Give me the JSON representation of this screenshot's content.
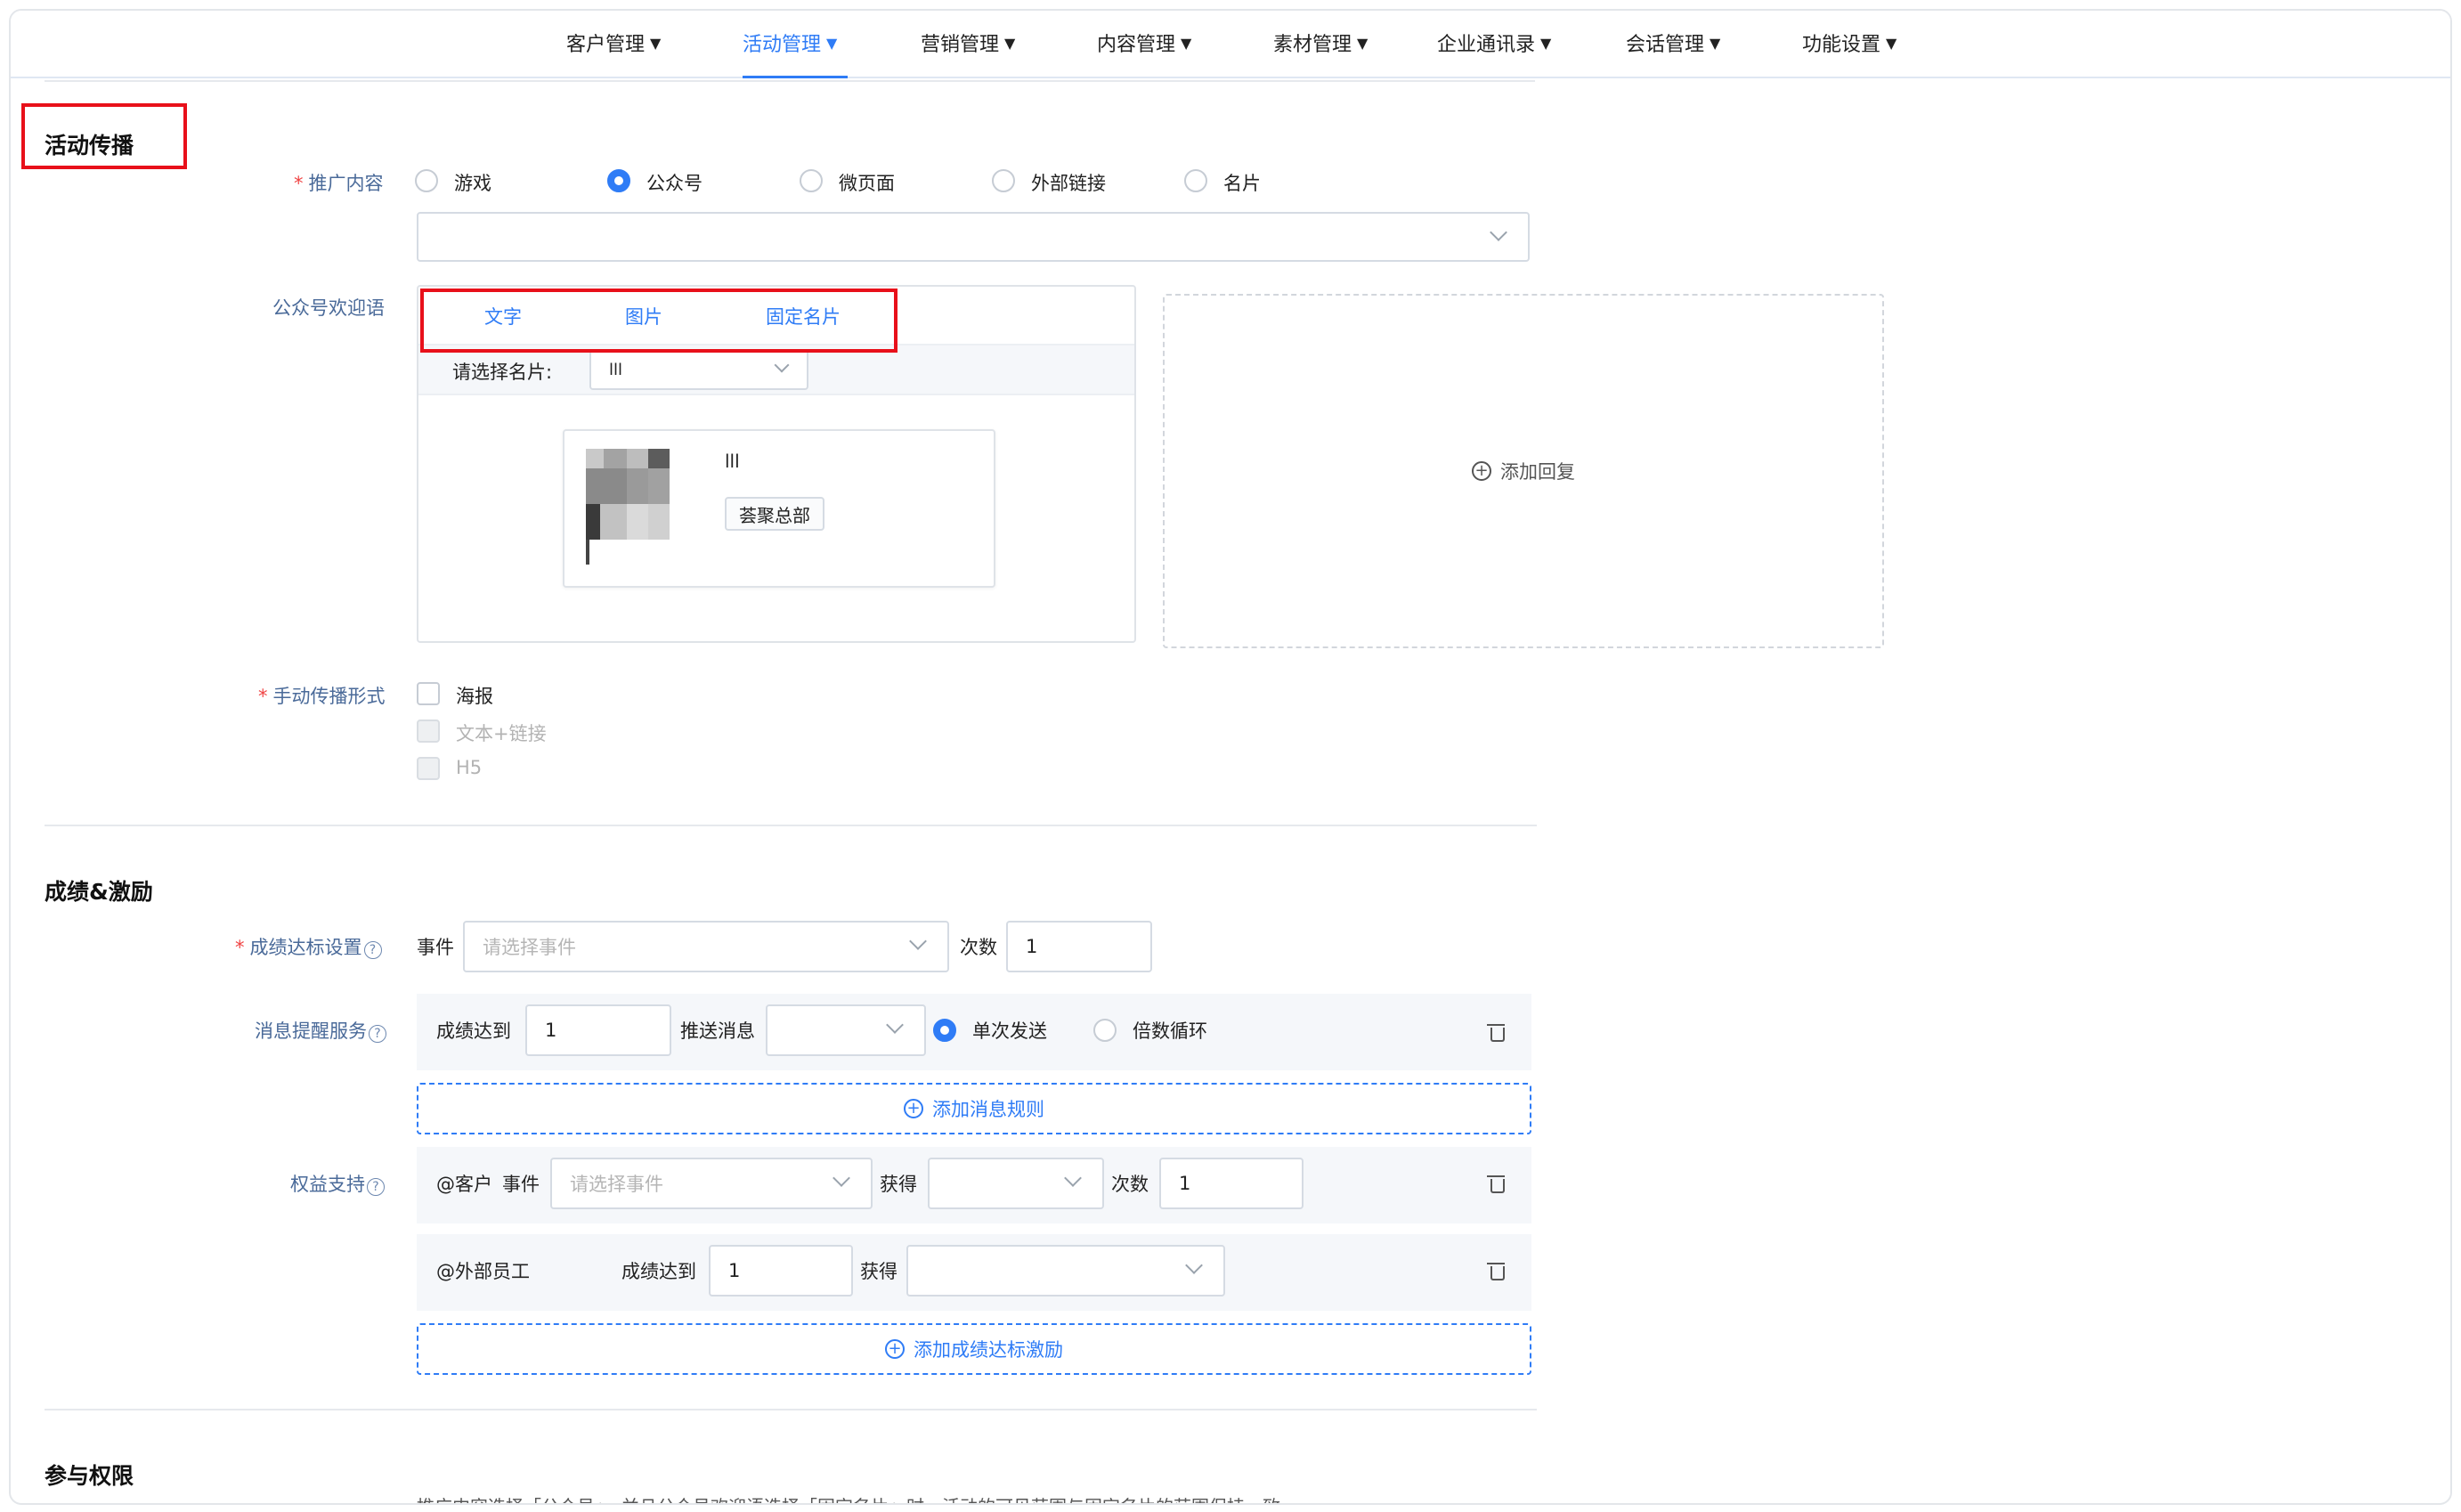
{
  "nav": {
    "items": [
      "客户管理",
      "活动管理",
      "营销管理",
      "内容管理",
      "素材管理",
      "企业通讯录",
      "会话管理",
      "功能设置"
    ],
    "active_index": 1,
    "caret": "▼"
  },
  "section1": {
    "title": "活动传播",
    "promo_label": "推广内容",
    "promo_options": [
      "游戏",
      "公众号",
      "微页面",
      "外部链接",
      "名片"
    ],
    "promo_selected": "公众号",
    "welcome_label": "公众号欢迎语",
    "welcome_tabs": [
      "文字",
      "图片",
      "固定名片"
    ],
    "welcome_active_tab": "固定名片",
    "select_card_label": "请选择名片:",
    "select_card_value": "lll",
    "card_name": "lll",
    "card_tag": "荟聚总部",
    "add_reply": "添加回复",
    "manual_label": "手动传播形式",
    "manual_options": [
      {
        "label": "海报",
        "checked": false,
        "disabled": false
      },
      {
        "label": "文本+链接",
        "checked": false,
        "disabled": true
      },
      {
        "label": "H5",
        "checked": false,
        "disabled": true
      }
    ]
  },
  "section2": {
    "title": "成绩&激励",
    "goal_label": "成绩达标设置",
    "event_label": "事件",
    "event_placeholder": "请选择事件",
    "times_label": "次数",
    "times_value": "1",
    "msg_label": "消息提醒服务",
    "msg_reach_label": "成绩达到",
    "msg_reach_value": "1",
    "msg_push_label": "推送消息",
    "msg_modes": [
      "单次发送",
      "倍数循环"
    ],
    "msg_mode_selected": "单次发送",
    "add_msg_rule": "添加消息规则",
    "rights_label": "权益支持",
    "rights_row1": {
      "who": "@客户",
      "event_label": "事件",
      "event_placeholder": "请选择事件",
      "get_label": "获得",
      "times_label": "次数",
      "times_value": "1"
    },
    "rights_row2": {
      "who": "@外部员工",
      "reach_label": "成绩达到",
      "reach_value": "1",
      "get_label": "获得"
    },
    "add_goal_incentive": "添加成绩达标激励"
  },
  "section3": {
    "title": "参与权限",
    "note": "推广内容选择「公众号」，并且公众号欢迎语选择「固定名片」时，活动的可见范围与固定名片的范围保持一致"
  },
  "colors": {
    "accent": "#2f7cf6",
    "highlight_box": "#e8101a",
    "label": "#4a6a99",
    "required": "#f04444"
  }
}
